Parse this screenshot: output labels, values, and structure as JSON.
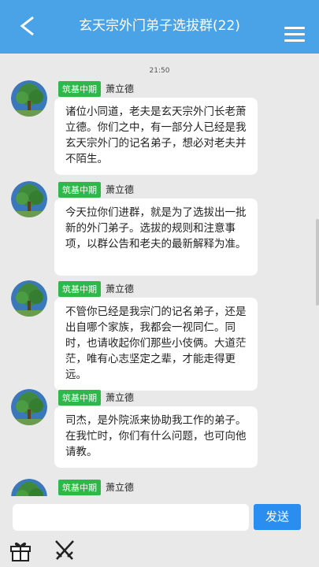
{
  "header": {
    "title": "玄天宗外门弟子选拔群(22)",
    "back_icon": "back-chevron-icon",
    "menu_icon": "hamburger-menu-icon"
  },
  "chat": {
    "timestamp": "21:50",
    "messages": [
      {
        "rank": "筑基中期",
        "name": "萧立德",
        "text": "诸位小同道，老夫是玄天宗外门长老萧立德。你们之中，有一部分人已经是我玄天宗外门的记名弟子，想必对老夫并不陌生。"
      },
      {
        "rank": "筑基中期",
        "name": "萧立德",
        "text": "今天拉你们进群，就是为了选拔出一批新的外门弟子。选拔的规则和注意事项，以群公告和老夫的最新解释为准。"
      },
      {
        "rank": "筑基中期",
        "name": "萧立德",
        "text": "不管你已经是我宗门的记名弟子，还是出自哪个家族，我都会一视同仁。同时，也请收起你们那些小伎俩。大道茫茫，唯有心志坚定之辈，才能走得更远。"
      },
      {
        "rank": "筑基中期",
        "name": "萧立德",
        "text": "司杰，是外院派来协助我工作的弟子。在我忙时，你们有什么问题，也可向他请教。"
      },
      {
        "rank": "筑基中期",
        "name": "萧立德",
        "text": ""
      }
    ]
  },
  "composer": {
    "input_value": "",
    "send_label": "发送",
    "gift_icon": "gift-icon",
    "swords_icon": "crossed-swords-icon"
  },
  "colors": {
    "header": "#4aa3e6",
    "rank_badge": "#2fb84a",
    "send_button": "#2a8ef0",
    "background": "#e9e9e9"
  }
}
